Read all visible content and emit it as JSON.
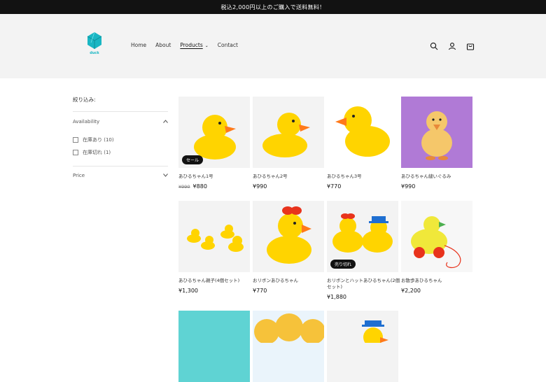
{
  "announcement": "税込2,000円以上のご購入で送料無料！",
  "logo": {
    "text": "duck"
  },
  "nav": {
    "home": "Home",
    "about": "About",
    "products": "Products",
    "contact": "Contact"
  },
  "filter": {
    "title": "絞り込み:",
    "availability": "Availability",
    "in_stock": "在庫あり (10)",
    "out_of_stock": "在庫切れ (1)",
    "price": "Price"
  },
  "products": [
    {
      "name": "あひるちゃん1号",
      "old_price": "¥990",
      "price": "¥880",
      "badge": "セール"
    },
    {
      "name": "あひるちゃん2号",
      "price": "¥990"
    },
    {
      "name": "あひるちゃん3号",
      "price": "¥770"
    },
    {
      "name": "あひるちゃん縫いぐるみ",
      "price": "¥990"
    },
    {
      "name": "あひるちゃん親子(4個セット)",
      "price": "¥1,300"
    },
    {
      "name": "おリボンあひるちゃん",
      "price": "¥770"
    },
    {
      "name": "おリボンとハットあひるちゃん(2個セット)",
      "price": "¥1,880",
      "badge": "売り切れ"
    },
    {
      "name": "お散歩あひるちゃん",
      "price": "¥2,200"
    }
  ],
  "colors": {
    "accent": "#19b6c3",
    "duck_yellow": "#ffd400",
    "beak": "#ff7a1a",
    "plush_bg": "#b07ad6",
    "teal_tile": "#5fd3d3"
  }
}
